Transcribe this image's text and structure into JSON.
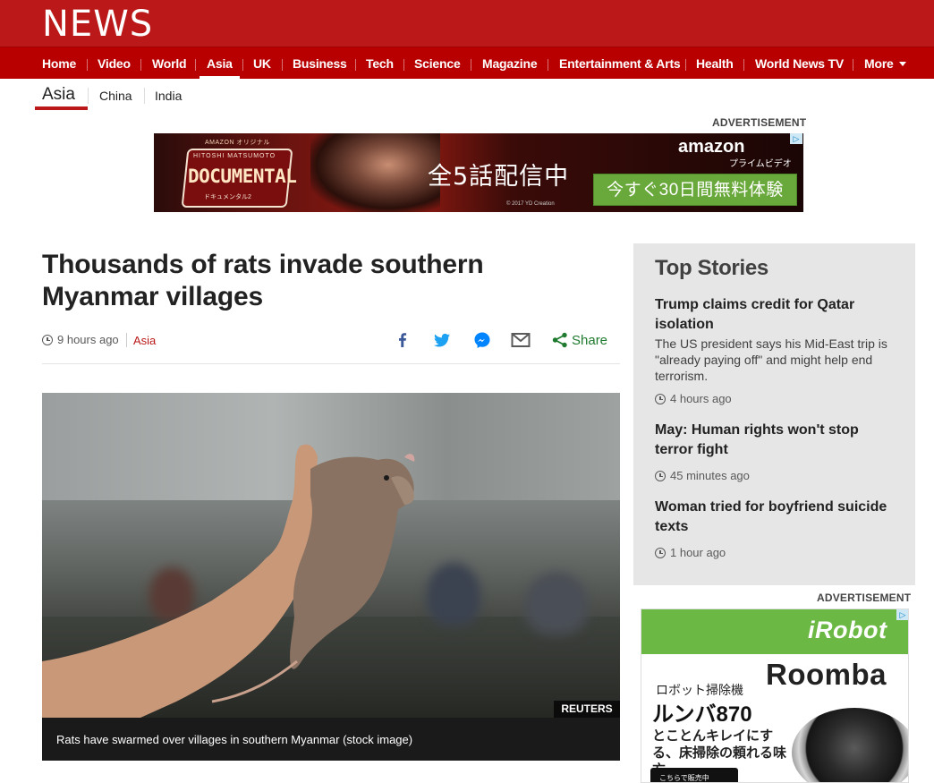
{
  "header": {
    "logo": "NEWS",
    "nav": [
      "Home",
      "Video",
      "World",
      "Asia",
      "UK",
      "Business",
      "Tech",
      "Science",
      "Magazine",
      "Entertainment & Arts",
      "Health",
      "World News TV",
      "More"
    ],
    "active_nav": "Asia"
  },
  "subnav": {
    "title": "Asia",
    "items": [
      "China",
      "India"
    ]
  },
  "ads": {
    "label": "ADVERTISEMENT",
    "banner": {
      "small_text": "AMAZON オリジナル",
      "badge_top": "HITOSHI MATSUMOTO",
      "badge_title": "DOCUMENTAL",
      "badge_sub": "ドキュメンタル2",
      "headline": "全5話配信中",
      "copyright": "© 2017 YD Creation",
      "brand": "amazon",
      "brand_sub": "プライムビデオ",
      "cta": "今すぐ30日間無料体験"
    },
    "side": {
      "brand": "iRobot",
      "product": "Roomba",
      "line1": "ロボット掃除機",
      "line2": "ルンバ870",
      "line3": "とことんキレイにする、床掃除の頼れる味方。",
      "button": "こちらで販売中"
    }
  },
  "article": {
    "headline": "Thousands of rats invade southern Myanmar villages",
    "time": "9 hours ago",
    "section": "Asia",
    "share_label": "Share",
    "image_credit": "REUTERS",
    "caption": "Rats have swarmed over villages in southern Myanmar (stock image)"
  },
  "top_stories": {
    "title": "Top Stories",
    "items": [
      {
        "headline": "Trump claims credit for Qatar isolation",
        "summary": "The US president says his Mid-East trip is \"already paying off\" and might help end terrorism.",
        "time": "4 hours ago"
      },
      {
        "headline": "May: Human rights won't stop terror fight",
        "time": "45 minutes ago"
      },
      {
        "headline": "Woman tried for boyfriend suicide texts",
        "time": "1 hour ago"
      }
    ]
  },
  "colors": {
    "brand_red": "#bb1919",
    "nav_red": "#b80000",
    "share_green": "#1e7a2e",
    "facebook_blue": "#3b5998",
    "twitter_blue": "#1da1f2",
    "messenger_blue": "#0084ff"
  },
  "icons": [
    "clock-icon",
    "facebook-icon",
    "twitter-icon",
    "messenger-icon",
    "email-icon",
    "share-icon",
    "chevron-down-icon",
    "adchoices-icon"
  ]
}
